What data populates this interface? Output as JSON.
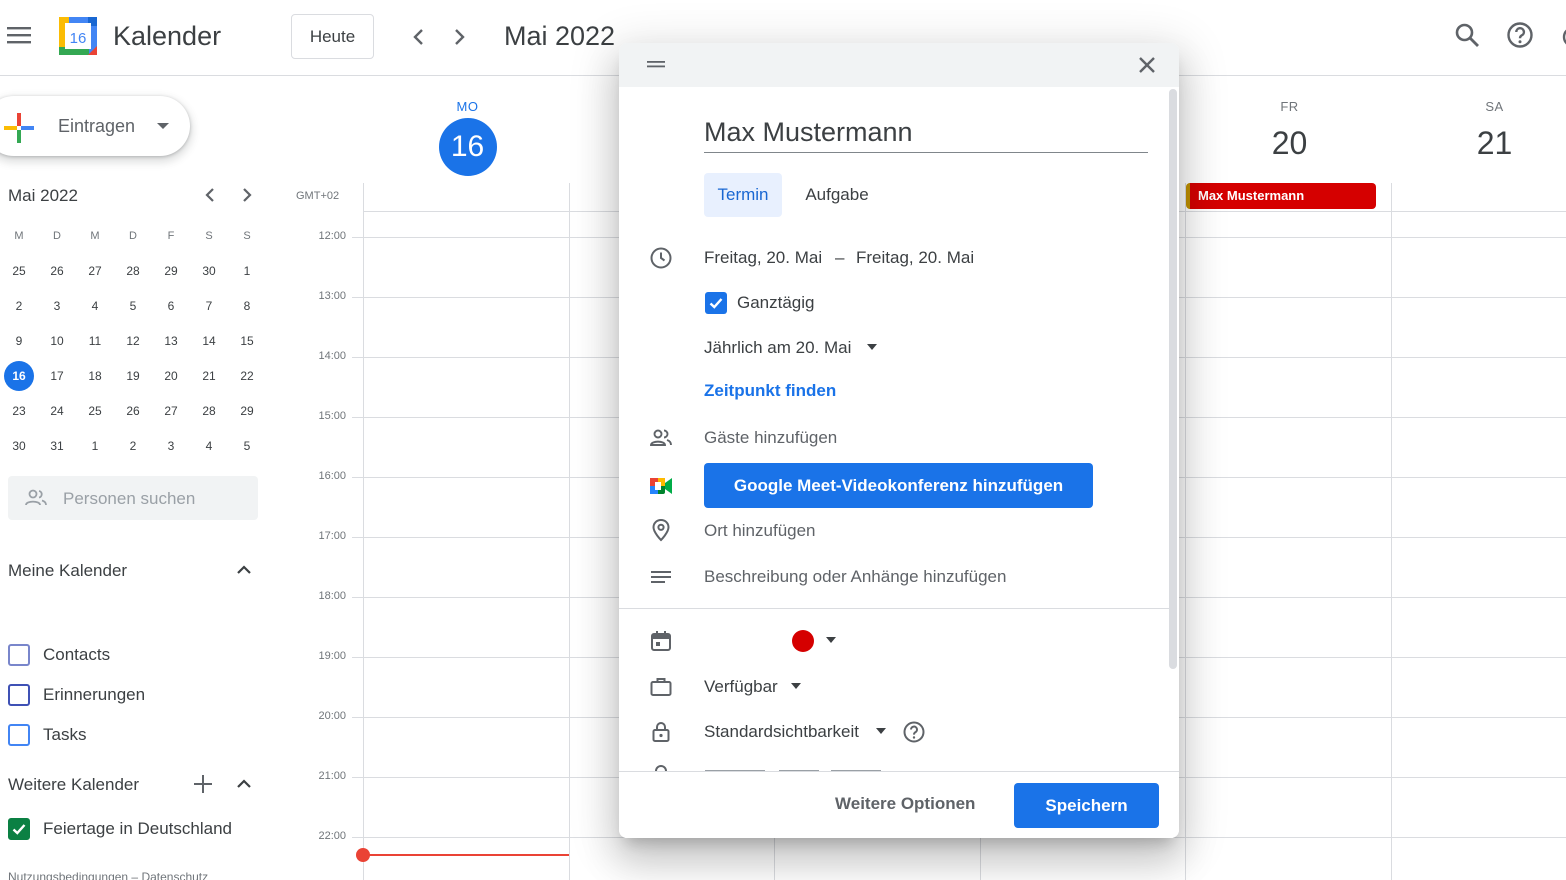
{
  "header": {
    "app_name": "Kalender",
    "logo_day": "16",
    "today_label": "Heute",
    "month_title": "Mai 2022"
  },
  "sidebar": {
    "create_label": "Eintragen",
    "mini_calendar": {
      "title": "Mai 2022",
      "weekday_heads": [
        "M",
        "D",
        "M",
        "D",
        "F",
        "S",
        "S"
      ],
      "weeks": [
        [
          "25",
          "26",
          "27",
          "28",
          "29",
          "30",
          "1"
        ],
        [
          "2",
          "3",
          "4",
          "5",
          "6",
          "7",
          "8"
        ],
        [
          "9",
          "10",
          "11",
          "12",
          "13",
          "14",
          "15"
        ],
        [
          "16",
          "17",
          "18",
          "19",
          "20",
          "21",
          "22"
        ],
        [
          "23",
          "24",
          "25",
          "26",
          "27",
          "28",
          "29"
        ],
        [
          "30",
          "31",
          "1",
          "2",
          "3",
          "4",
          "5"
        ]
      ],
      "today": "16"
    },
    "people_search_placeholder": "Personen suchen",
    "my_calendars_title": "Meine Kalender",
    "my_calendars": [
      {
        "label": "Contacts",
        "color": "#7986cb",
        "checked": false
      },
      {
        "label": "Erinnerungen",
        "color": "#3f51b5",
        "checked": false
      },
      {
        "label": "Tasks",
        "color": "#4285f4",
        "checked": false
      }
    ],
    "other_calendars_title": "Weitere Kalender",
    "other_calendars": [
      {
        "label": "Feiertage in Deutschland",
        "color": "#0b8043",
        "checked": true
      }
    ],
    "footer": "Nutzungsbedingungen – Datenschutz"
  },
  "week": {
    "timezone": "GMT+02",
    "days": [
      {
        "dow": "MO",
        "num": "16",
        "today": true
      },
      {
        "dow": "FR",
        "num": "20",
        "today": false
      },
      {
        "dow": "SA",
        "num": "21",
        "today": false
      }
    ],
    "hours": [
      "12:00",
      "13:00",
      "14:00",
      "15:00",
      "16:00",
      "17:00",
      "18:00",
      "19:00",
      "20:00",
      "21:00",
      "22:00"
    ],
    "allday_event": {
      "title": "Max Mustermann",
      "color": "#d50000"
    }
  },
  "dialog": {
    "title_value": "Max Mustermann",
    "tabs": {
      "event": "Termin",
      "task": "Aufgabe"
    },
    "date_start": "Freitag, 20. Mai",
    "date_separator": "–",
    "date_end": "Freitag, 20. Mai",
    "allday_label": "Ganztägig",
    "allday_checked": true,
    "repeat_label": "Jährlich am 20. Mai",
    "find_time_label": "Zeitpunkt finden",
    "guests_placeholder": "Gäste hinzufügen",
    "meet_button": "Google Meet-Videokonferenz hinzufügen",
    "location_placeholder": "Ort hinzufügen",
    "description_placeholder": "Beschreibung oder Anhänge hinzufügen",
    "event_color": "#d50000",
    "availability_label": "Verfügbar",
    "visibility_label": "Standardsichtbarkeit",
    "more_options_label": "Weitere Optionen",
    "save_label": "Speichern"
  },
  "colors": {
    "accent": "#1a73e8",
    "now_line": "#ea4335"
  },
  "icons": {
    "menu": "hamburger-icon",
    "search": "search-icon",
    "help": "help-icon",
    "time": "clock-icon",
    "guests": "people-icon",
    "meet": "google-meet-icon",
    "location": "location-pin-icon",
    "description": "notes-icon",
    "calendar": "calendar-icon",
    "availability": "briefcase-icon",
    "visibility": "lock-icon"
  }
}
